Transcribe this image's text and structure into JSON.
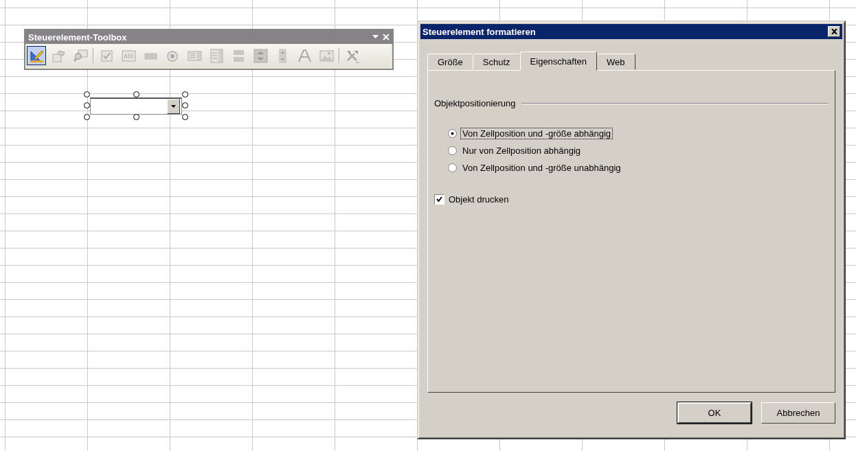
{
  "toolbox": {
    "title": "Steuerelement-Toolbox",
    "tools": [
      {
        "kind": "tool",
        "selected": true
      },
      {
        "kind": "tool",
        "selected": false
      },
      {
        "kind": "tool",
        "selected": false
      },
      {
        "kind": "separator"
      },
      {
        "kind": "tool",
        "selected": false
      },
      {
        "kind": "tool",
        "selected": false
      },
      {
        "kind": "tool",
        "selected": false
      },
      {
        "kind": "tool",
        "selected": false
      },
      {
        "kind": "tool",
        "selected": false
      },
      {
        "kind": "tool",
        "selected": false
      },
      {
        "kind": "tool",
        "selected": false
      },
      {
        "kind": "tool",
        "selected": false
      },
      {
        "kind": "tool",
        "selected": false
      },
      {
        "kind": "tool",
        "selected": false
      },
      {
        "kind": "tool",
        "selected": false
      },
      {
        "kind": "separator"
      },
      {
        "kind": "tool",
        "selected": false
      }
    ]
  },
  "sheet_control": {
    "kind": "combobox",
    "selected": true
  },
  "dialog": {
    "title": "Steuerelement formatieren",
    "tabs": [
      {
        "label": "Größe",
        "selected": false
      },
      {
        "label": "Schutz",
        "selected": false
      },
      {
        "label": "Eigenschaften",
        "selected": true
      },
      {
        "label": "Web",
        "selected": false
      }
    ],
    "group": {
      "label": "Objektpositionierung",
      "options": [
        {
          "label": "Von Zellposition und -größe abhängig",
          "selected": true,
          "focused": true
        },
        {
          "label": "Nur von Zellposition abhängig",
          "selected": false,
          "focused": false
        },
        {
          "label": "Von Zellposition und -größe unabhängig",
          "selected": false,
          "focused": false
        }
      ]
    },
    "checkbox": {
      "label": "Objekt drucken",
      "checked": true
    },
    "buttons": [
      {
        "label": "OK",
        "default": true
      },
      {
        "label": "Abbrechen",
        "default": false
      }
    ]
  }
}
